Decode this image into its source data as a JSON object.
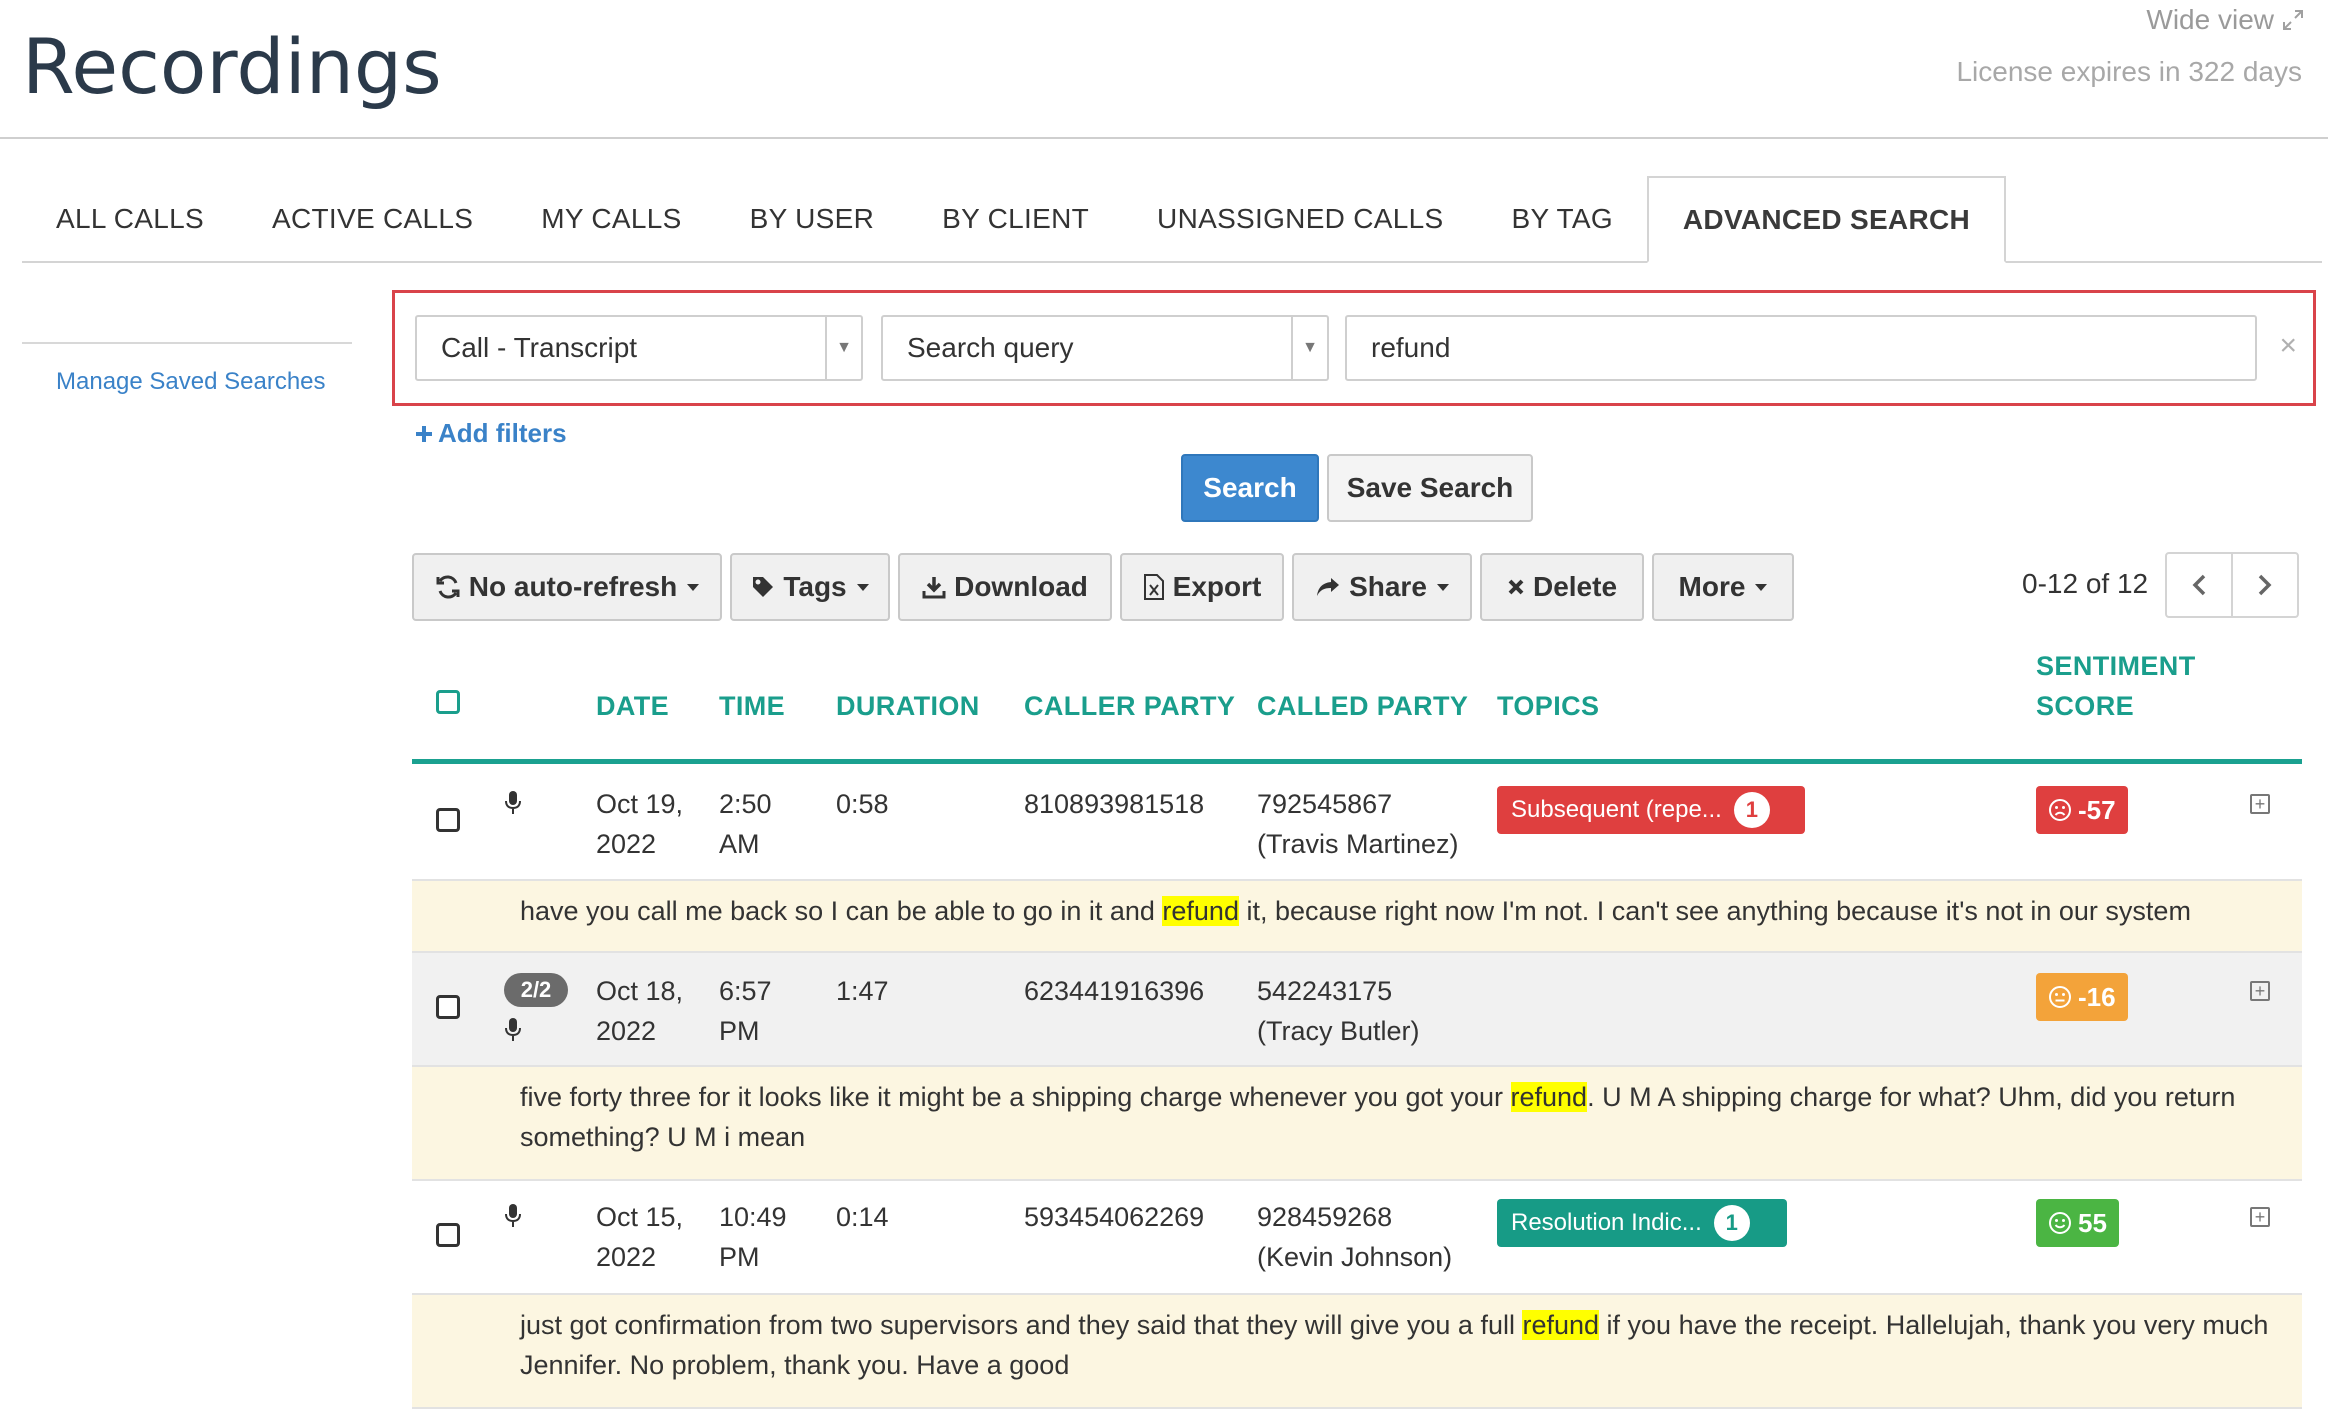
{
  "header": {
    "title": "Recordings",
    "wide_view": "Wide view",
    "license": "License expires in 322 days"
  },
  "tabs": [
    {
      "label": "ALL CALLS",
      "active": false
    },
    {
      "label": "ACTIVE CALLS",
      "active": false
    },
    {
      "label": "MY CALLS",
      "active": false
    },
    {
      "label": "BY USER",
      "active": false
    },
    {
      "label": "BY CLIENT",
      "active": false
    },
    {
      "label": "UNASSIGNED CALLS",
      "active": false
    },
    {
      "label": "BY TAG",
      "active": false
    },
    {
      "label": "ADVANCED SEARCH",
      "active": true
    }
  ],
  "sidebar": {
    "manage_saved_searches": "Manage Saved Searches"
  },
  "search": {
    "field_select": "Call - Transcript",
    "mode_select": "Search query",
    "query": "refund",
    "clear": "×",
    "add_filters": "Add filters",
    "search_button": "Search",
    "save_search_button": "Save Search"
  },
  "toolbar": {
    "auto_refresh": "No auto-refresh",
    "tags": "Tags",
    "download": "Download",
    "export": "Export",
    "share": "Share",
    "delete": "Delete",
    "more": "More"
  },
  "pager": {
    "text": "0-12 of 12"
  },
  "table": {
    "columns": {
      "date": "DATE",
      "time": "TIME",
      "duration": "DURATION",
      "caller_party": "CALLER PARTY",
      "called_party": "CALLED PARTY",
      "topics": "TOPICS",
      "sentiment_1": "SENTIMENT",
      "sentiment_2": "SCORE"
    },
    "rows": [
      {
        "date_1": "Oct 19,",
        "date_2": "2022",
        "time_1": "2:50",
        "time_2": "AM",
        "duration": "0:58",
        "caller": "810893981518",
        "called_1": "792545867",
        "called_2": "(Travis Martinez)",
        "topic": "Subsequent (repe...",
        "topic_count": "1",
        "topic_color": "#df3f3f",
        "score": "-57",
        "score_icon": "frown-face-icon",
        "score_color": "#df3f3f",
        "snippet_before": "have you call me back so I can be able to go in it and ",
        "snippet_hl": "refund",
        "snippet_after": " it, because right now I'm not. I can't see anything because it's not in our system"
      },
      {
        "badge": "2/2",
        "date_1": "Oct 18,",
        "date_2": "2022",
        "time_1": "6:57",
        "time_2": "PM",
        "duration": "1:47",
        "caller": "623441916396",
        "called_1": "542243175",
        "called_2": "(Tracy Butler)",
        "score": "-16",
        "score_icon": "neutral-face-icon",
        "score_color": "#f3a33a",
        "snippet_before": "five forty three for it looks like it might be a shipping charge whenever you got your ",
        "snippet_hl": "refund",
        "snippet_after": ". U M A shipping charge for what? Uhm, did you return something? U M i mean"
      },
      {
        "date_1": "Oct 15,",
        "date_2": "2022",
        "time_1": "10:49",
        "time_2": "PM",
        "duration": "0:14",
        "caller": "593454062269",
        "called_1": "928459268",
        "called_2": "(Kevin Johnson)",
        "topic": "Resolution Indic...",
        "topic_count": "1",
        "topic_color": "#179b86",
        "score": "55",
        "score_icon": "smile-face-icon",
        "score_color": "#4bb543",
        "snippet_before": "just got confirmation from two supervisors and they said that they will give you a full ",
        "snippet_hl": "refund",
        "snippet_after": " if you have the receipt. Hallelujah, thank you very much Jennifer. No problem, thank you. Have a good"
      }
    ]
  }
}
